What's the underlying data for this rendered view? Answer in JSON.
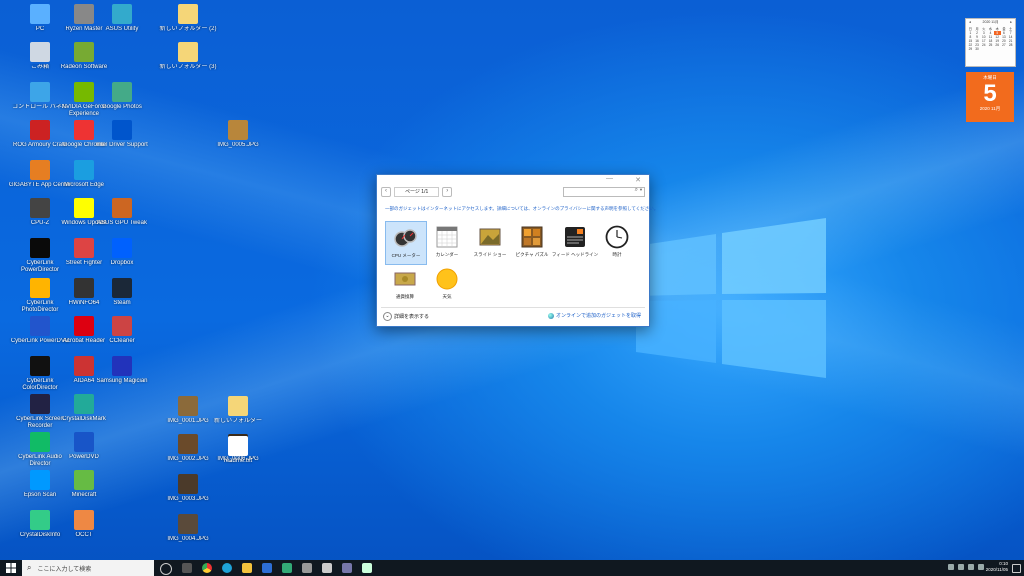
{
  "desktop": {
    "icons": [
      {
        "label": "PC"
      },
      {
        "label": "ごみ箱"
      },
      {
        "label": "コントロール パネル"
      },
      {
        "label": "ROG Armoury Crate"
      },
      {
        "label": "GIGABYTE App Center"
      },
      {
        "label": "CPU-Z"
      },
      {
        "label": "CyberLink PowerDirector"
      },
      {
        "label": "CyberLink PhotoDirector"
      },
      {
        "label": "CyberLink PowerDVD"
      },
      {
        "label": "CyberLink ColorDirector"
      },
      {
        "label": "CyberLink Screen Recorder"
      },
      {
        "label": "CyberLink Audio Director"
      },
      {
        "label": "Epson Scan"
      },
      {
        "label": "CrystalDiskInfo"
      },
      {
        "label": "Ryzen Master"
      },
      {
        "label": "Radeon Software"
      },
      {
        "label": "NVIDIA GeForce Experience"
      },
      {
        "label": "Google Chrome"
      },
      {
        "label": "Microsoft Edge"
      },
      {
        "label": "Windows Update"
      },
      {
        "label": "Street Fighter"
      },
      {
        "label": "HWiNFO64"
      },
      {
        "label": "Acrobat Reader"
      },
      {
        "label": "AIDA64"
      },
      {
        "label": "CrystalDiskMark"
      },
      {
        "label": "PowerDVD"
      },
      {
        "label": "Minecraft"
      },
      {
        "label": "OCCT"
      },
      {
        "label": "ASUS Utility"
      },
      {
        "label": "Google Photos"
      },
      {
        "label": "Intel Driver Support"
      },
      {
        "label": "ASUS GPU Tweak"
      },
      {
        "label": "Steam"
      },
      {
        "label": "Dropbox"
      },
      {
        "label": "CCleaner"
      },
      {
        "label": "Samsung Magician"
      },
      {
        "label": "IMG_0001.JPG"
      },
      {
        "label": "IMG_0002.JPG"
      },
      {
        "label": "IMG_0003.JPG"
      },
      {
        "label": "IMG_0004.JPG"
      },
      {
        "label": "IMG_0005.JPG"
      },
      {
        "label": "IMG_0006.JPG"
      },
      {
        "label": "新しいフォルダー (2)"
      },
      {
        "label": "新しいフォルダー (3)"
      },
      {
        "label": "新しいフォルダー"
      },
      {
        "label": "readme.txt"
      }
    ]
  },
  "gadgets_window": {
    "page_label": "ページ 1/1",
    "search_placeholder": "",
    "notice": "一部のガジェットはインターネットにアクセスします。詳細については、オンラインのプライバシーに関する声明を参照してください。",
    "items": [
      {
        "label": "CPU メーター",
        "selected": true
      },
      {
        "label": "カレンダー"
      },
      {
        "label": "スライド ショー"
      },
      {
        "label": "ピクチャ パズル"
      },
      {
        "label": "フィード ヘッドライン"
      },
      {
        "label": "時計"
      },
      {
        "label": "通貨換算"
      },
      {
        "label": "天気"
      }
    ],
    "details_label": "詳細を表示する",
    "online_label": "オンラインで追加のガジェットを取得"
  },
  "calendar_gadget": {
    "month_title": "2020 11月",
    "weekdays": [
      "日",
      "月",
      "火",
      "水",
      "木",
      "金",
      "土"
    ],
    "days": [
      "1",
      "2",
      "3",
      "4",
      "5",
      "6",
      "7",
      "8",
      "9",
      "10",
      "11",
      "12",
      "13",
      "14",
      "15",
      "16",
      "17",
      "18",
      "19",
      "20",
      "21",
      "22",
      "23",
      "24",
      "25",
      "26",
      "27",
      "28",
      "29",
      "30"
    ],
    "today": "5",
    "big_weekday": "木曜日",
    "big_day": "5",
    "big_year_month": "2020 11月"
  },
  "taskbar": {
    "search_placeholder": "ここに入力して検索",
    "time": "0:10",
    "date": "2020/11/05"
  },
  "colors": {
    "desktop_blue": "#0a6ae0",
    "calendar_orange": "#f26b1d",
    "taskbar": "#101820"
  }
}
